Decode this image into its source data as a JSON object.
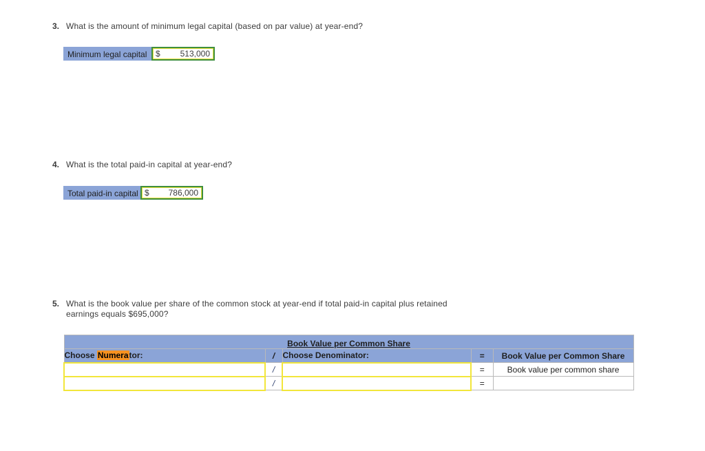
{
  "questions": [
    {
      "number": "3.",
      "text": "What is the amount of minimum legal capital (based on par value) at year-end?",
      "label": "Minimum legal capital",
      "currency": "$",
      "amount": "513,000"
    },
    {
      "number": "4.",
      "text": "What is the total paid-in capital at year-end?",
      "label": "Total paid-in capital",
      "currency": "$",
      "amount": "786,000"
    },
    {
      "number": "5.",
      "text": "What is the book value per share of the common stock at year-end if total paid-in capital plus retained earnings equals $695,000?"
    }
  ],
  "book_value_table": {
    "title": "Book Value per Common Share",
    "headers": {
      "numerator": "Choose Numerator:",
      "numerator_highlight": "Numera",
      "numerator_prefix": "Choose ",
      "numerator_suffix": "tor:",
      "divide_op": "/",
      "denominator": "Choose Denominator:",
      "equals_op": "=",
      "result": "Book Value per Common Share"
    },
    "rows": [
      {
        "numerator": "",
        "divide_op": "/",
        "denominator": "",
        "equals_op": "=",
        "result": "Book value per common share"
      },
      {
        "numerator": "",
        "divide_op": "/",
        "denominator": "",
        "equals_op": "=",
        "result": ""
      }
    ]
  },
  "colors": {
    "header_blue": "#8ba4d7",
    "highlight_orange": "#f79321",
    "active_cell_green": "#3f8f3f",
    "input_yellow": "#f2e63a"
  }
}
